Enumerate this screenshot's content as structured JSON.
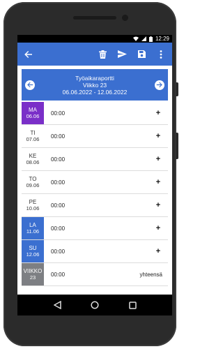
{
  "status_bar": {
    "time": "12:29"
  },
  "app_bar": {
    "back_icon": "arrow-left-icon",
    "actions": [
      "trash-icon",
      "send-icon",
      "save-icon",
      "more-vert-icon"
    ]
  },
  "report": {
    "title": "Työaikaraportti",
    "week": "Viikko 23",
    "range": "06.06.2022 - 12.06.2022"
  },
  "days": [
    {
      "name": "MA",
      "date": "06.06",
      "time": "00:00",
      "style": "today"
    },
    {
      "name": "TI",
      "date": "07.06",
      "time": "00:00",
      "style": "normal"
    },
    {
      "name": "KE",
      "date": "08.06",
      "time": "00:00",
      "style": "normal"
    },
    {
      "name": "TO",
      "date": "09.06",
      "time": "00:00",
      "style": "normal"
    },
    {
      "name": "PE",
      "date": "10.06",
      "time": "00:00",
      "style": "normal"
    },
    {
      "name": "LA",
      "date": "11.06",
      "time": "00:00",
      "style": "weekend"
    },
    {
      "name": "SU",
      "date": "12.06",
      "time": "00:00",
      "style": "weekend"
    }
  ],
  "week_total": {
    "name": "VIIKKO",
    "number": "23",
    "time": "00:00",
    "label": "yhteensä"
  },
  "plus_label": "+",
  "colors": {
    "primary": "#3b6fd0",
    "today": "#7a2fc8",
    "week": "#7d7f83"
  }
}
